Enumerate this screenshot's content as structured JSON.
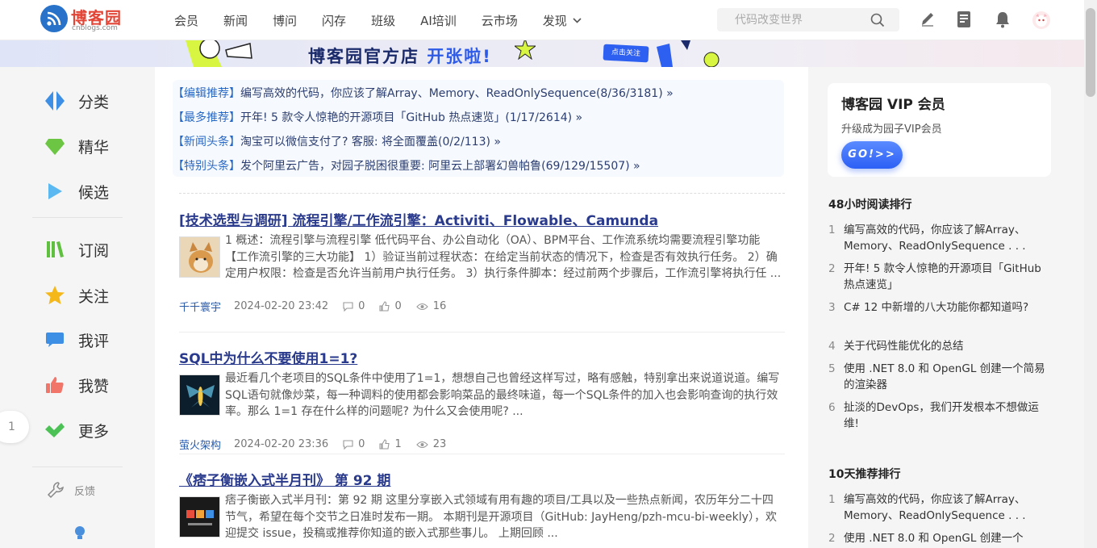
{
  "header": {
    "logo_text": "博客园",
    "logo_sub": "cnblogs.com",
    "nav": [
      "会员",
      "新闻",
      "博问",
      "闪存",
      "班级",
      "AI培训",
      "云市场"
    ],
    "nav_more": "发现",
    "search_placeholder": "代码改变世界"
  },
  "banner": {
    "title_main": "博客园官方店",
    "title_accent": "开张啦!",
    "button": "点击关注"
  },
  "sidebar": {
    "items": [
      {
        "label": "分类",
        "icon": "diamond-split-icon",
        "color": "#3d8fe6"
      },
      {
        "label": "精华",
        "icon": "gem-icon",
        "color": "#6cc644"
      },
      {
        "label": "候选",
        "icon": "play-triangle-icon",
        "color": "#5cb8f0"
      },
      {
        "label": "订阅",
        "icon": "books-icon",
        "color": "#5fbf3f"
      },
      {
        "label": "关注",
        "icon": "star-icon",
        "color": "#f5b81b"
      },
      {
        "label": "我评",
        "icon": "comment-icon",
        "color": "#3d8fe6"
      },
      {
        "label": "我赞",
        "icon": "thumbs-up-icon",
        "color": "#f2756a"
      },
      {
        "label": "更多",
        "icon": "checkmark-icon",
        "color": "#4cc256"
      }
    ],
    "feedback": "反馈",
    "page": "1"
  },
  "headlines": [
    {
      "tag": "【编辑推荐】",
      "text": "编写高效的代码，你应该了解Array、Memory、ReadOnlySequence(8/36/3181) »"
    },
    {
      "tag": "【最多推荐】",
      "text": "开年! 5 款令人惊艳的开源项目「GitHub 热点速览」(1/17/2614) »"
    },
    {
      "tag": "【新闻头条】",
      "text": "淘宝可以微信支付了? 客服: 将全面覆盖(0/2/113) »"
    },
    {
      "tag": "【特别头条】",
      "text": "发个阿里云广告，对园子脱困很重要: 阿里云上部署幻兽帕鲁(69/129/15507) »"
    }
  ],
  "posts": [
    {
      "title": "[技术选型与调研] 流程引擎/工作流引擎：Activiti、Flowable、Camunda",
      "summary": "1 概述：流程引擎与流程引擎 低代码平台、办公自动化（OA）、BPM平台、工作流系统均需要流程引擎功能 【工作流引擎的三大功能】 1）验证当前过程状态：在给定当前状态的情况下，检查是否有效执行任务。 2）确定用户权限：检查是否允许当前用户执行任务。 3）执行条件脚本：经过前两个步骤后，工作流引擎将执行任 ...",
      "author": "千千寰宇",
      "date": "2024-02-20 23:42",
      "comments": "0",
      "likes": "0",
      "views": "16"
    },
    {
      "title": "SQL中为什么不要使用1=1?",
      "summary": "最近看几个老项目的SQL条件中使用了1=1，想想自己也曾经这样写过，略有感触，特别拿出来说道说道。编写SQL语句就像炒菜，每一种调料的使用都会影响菜品的最终味道，每一个SQL条件的加入也会影响查询的执行效率。那么 1=1 存在什么样的问题呢? 为什么又会使用呢? ...",
      "author": "萤火架构",
      "date": "2024-02-20 23:36",
      "comments": "0",
      "likes": "1",
      "views": "23"
    },
    {
      "title": "《痞子衡嵌入式半月刊》 第 92 期",
      "summary": "痞子衡嵌入式半月刊：第 92 期 这里分享嵌入式领域有用有趣的项目/工具以及一些热点新闻，农历年分二十四节气，希望在每个交节之日准时发布一期。 本期刊是开源项目（GitHub: JayHeng/pzh-mcu-bi-weekly），欢迎提交 issue，投稿或推荐你知道的嵌入式那些事儿。 上期回顾 ..."
    }
  ],
  "vip": {
    "title": "博客园 VIP 会员",
    "sub": "升级成为园子VIP会员",
    "button": "GO!>>"
  },
  "rank48": {
    "title": "48小时阅读排行",
    "items": [
      {
        "num": "1",
        "text": "编写高效的代码，你应该了解Array、Memory、ReadOnlySequence . . ."
      },
      {
        "num": "2",
        "text": "开年! 5 款令人惊艳的开源项目「GitHub 热点速览」"
      },
      {
        "num": "3",
        "text": "C# 12 中新增的八大功能你都知道吗?"
      },
      {
        "num": "4",
        "text": "关于代码性能优化的总结"
      },
      {
        "num": "5",
        "text": "使用 .NET 8.0 和 OpenGL 创建一个简易的渲染器"
      },
      {
        "num": "6",
        "text": "扯淡的DevOps，我们开发根本不想做运维!"
      }
    ]
  },
  "rank10": {
    "title": "10天推荐排行",
    "items": [
      {
        "num": "1",
        "text": "编写高效的代码，你应该了解Array、Memory、ReadOnlySequence . . ."
      },
      {
        "num": "2",
        "text": "使用 .NET 8.0 和 OpenGL 创建一个"
      }
    ]
  }
}
